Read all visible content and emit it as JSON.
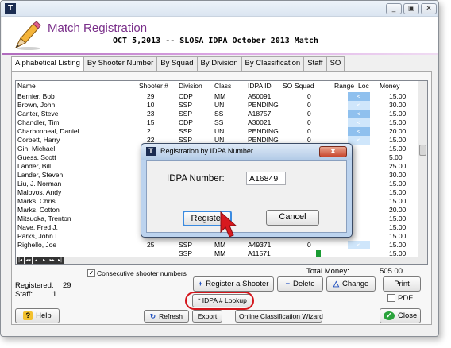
{
  "window": {
    "title_icon": "app-logo-icon",
    "title": "Match Registration",
    "subtitle": "OCT  5,2013 -- SLOSA IDPA October 2013 Match",
    "controls": [
      "_",
      "▣",
      "✕"
    ]
  },
  "tabs": [
    {
      "label": "Alphabetical Listing",
      "active": true
    },
    {
      "label": "By Shooter Number"
    },
    {
      "label": "By Squad"
    },
    {
      "label": "By Division"
    },
    {
      "label": "By Classification"
    },
    {
      "label": "Staff"
    },
    {
      "label": "SO"
    }
  ],
  "grid": {
    "columns": [
      "Name",
      "Shooter #",
      "Division",
      "Class",
      "IDPA ID",
      "SO",
      "Squad",
      "Range",
      "Loc",
      "Money"
    ],
    "rows": [
      {
        "name": "Bernier, Bob",
        "num": "29",
        "div": "CDP",
        "cls": "MM",
        "id": "A50091",
        "squad": "0",
        "range": "<",
        "money": "15.00"
      },
      {
        "name": "Brown, John",
        "num": "10",
        "div": "SSP",
        "cls": "UN",
        "id": "PENDING",
        "squad": "0",
        "range": "<",
        "money": "30.00"
      },
      {
        "name": "Canter, Steve",
        "num": "23",
        "div": "SSP",
        "cls": "SS",
        "id": "A18757",
        "squad": "0",
        "range": "<",
        "money": "15.00"
      },
      {
        "name": "Chandler, Tim",
        "num": "15",
        "div": "CDP",
        "cls": "SS",
        "id": "A30021",
        "squad": "0",
        "range": "<",
        "money": "15.00"
      },
      {
        "name": "Charbonneal, Daniel",
        "num": "2",
        "div": "SSP",
        "cls": "UN",
        "id": "PENDING",
        "squad": "0",
        "range": "<",
        "money": "20.00"
      },
      {
        "name": "Corbett, Harry",
        "num": "22",
        "div": "SSP",
        "cls": "UN",
        "id": "PENDING",
        "squad": "0",
        "range": "<",
        "money": "15.00"
      },
      {
        "name": "Gin, Michael",
        "num": "",
        "div": "",
        "cls": "",
        "id": "",
        "squad": "",
        "range": "",
        "money": "15.00"
      },
      {
        "name": "Guess, Scott",
        "num": "",
        "div": "",
        "cls": "",
        "id": "",
        "squad": "",
        "range": "",
        "money": "5.00"
      },
      {
        "name": "Lander, Bill",
        "num": "",
        "div": "",
        "cls": "",
        "id": "",
        "squad": "",
        "range": "",
        "money": "25.00"
      },
      {
        "name": "Lander, Steven",
        "num": "",
        "div": "",
        "cls": "",
        "id": "",
        "squad": "",
        "range": "",
        "money": "30.00"
      },
      {
        "name": "Liu, J. Norman",
        "num": "",
        "div": "",
        "cls": "",
        "id": "",
        "squad": "",
        "range": "",
        "money": "15.00"
      },
      {
        "name": "Malovos, Andy",
        "num": "",
        "div": "",
        "cls": "",
        "id": "",
        "squad": "",
        "range": "",
        "money": "15.00"
      },
      {
        "name": "Marks, Chris",
        "num": "",
        "div": "",
        "cls": "",
        "id": "",
        "squad": "",
        "range": "",
        "money": "15.00"
      },
      {
        "name": "Marks, Cotton",
        "num": "",
        "div": "",
        "cls": "",
        "id": "",
        "squad": "",
        "range": "",
        "money": "20.00"
      },
      {
        "name": "Mitsuoka, Trenton",
        "num": "",
        "div": "",
        "cls": "",
        "id": "",
        "squad": "",
        "range": "",
        "money": "15.00"
      },
      {
        "name": "Nave, Fred J.",
        "num": "",
        "div": "",
        "cls": "",
        "id": "",
        "squad": "",
        "range": "",
        "money": "15.00"
      },
      {
        "name": "Parks, John L.",
        "num": "17",
        "div": "ESP",
        "cls": "",
        "id": "A19209",
        "squad": "",
        "range": "",
        "money": "15.00"
      },
      {
        "name": "Righello, Joe",
        "num": "25",
        "div": "SSP",
        "cls": "MM",
        "id": "A49371",
        "squad": "0",
        "range": "<",
        "money": "15.00"
      },
      {
        "name": "",
        "num": "",
        "div": "SSP",
        "cls": "MM",
        "id": "A11571",
        "squad": "",
        "range": "",
        "money": "15.00"
      }
    ]
  },
  "nav_buttons": [
    "|◂",
    "◂◂",
    "◂",
    "▸",
    "▸▸",
    "▸|"
  ],
  "options": {
    "consecutive_label": "Consecutive shooter numbers",
    "consecutive_checked": "✓"
  },
  "totals": {
    "total_money_label": "Total Money:",
    "total_money_value": "505.00",
    "registered_label": "Registered:",
    "registered_value": "29",
    "staff_label": "Staff:",
    "staff_value": "1"
  },
  "buttons": {
    "register": "Register a Shooter",
    "delete": "Delete",
    "change": "Change",
    "print": "Print",
    "pdf": "PDF",
    "lookup": "* IDPA # Lookup",
    "help": "Help",
    "refresh": "Refresh",
    "export": "Export",
    "wizard": "Online Classification Wizard",
    "close": "Close"
  },
  "dialog": {
    "title": "Registration by IDPA Number",
    "close": "x",
    "label": "IDPA Number:",
    "value": "A16849",
    "register": "Register",
    "cancel": "Cancel"
  },
  "colors": {
    "title": "#7a2f8a",
    "highlight_ring": "#d4161c",
    "range_cell": "#8fc0ee"
  }
}
